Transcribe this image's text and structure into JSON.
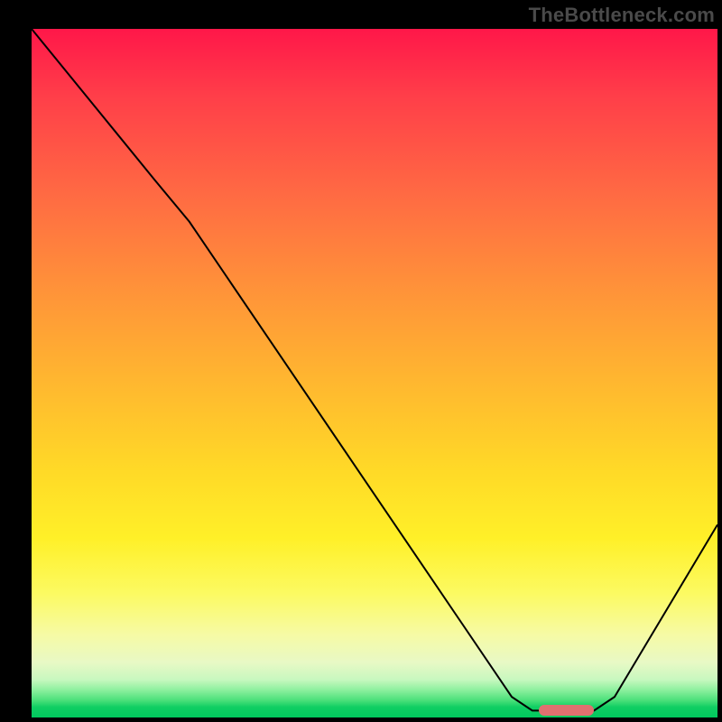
{
  "watermark": "TheBottleneck.com",
  "chart_data": {
    "type": "line",
    "title": "",
    "xlabel": "",
    "ylabel": "",
    "xlim": [
      0,
      100
    ],
    "ylim": [
      0,
      100
    ],
    "grid": false,
    "legend": false,
    "background_gradient": {
      "top": "#ff1749",
      "middle": "#ffd927",
      "bottom": "#00c95e",
      "note": "vertical gradient from red (top) through orange/yellow to green (bottom)"
    },
    "series": [
      {
        "name": "bottleneck-curve",
        "color": "#000000",
        "points": [
          {
            "x": 0,
            "y": 100
          },
          {
            "x": 18,
            "y": 78
          },
          {
            "x": 23,
            "y": 72
          },
          {
            "x": 70,
            "y": 3
          },
          {
            "x": 73,
            "y": 1
          },
          {
            "x": 82,
            "y": 1
          },
          {
            "x": 85,
            "y": 3
          },
          {
            "x": 100,
            "y": 28
          }
        ]
      }
    ],
    "annotations": [
      {
        "name": "optimal-marker",
        "type": "bar-segment",
        "x_start": 74,
        "x_end": 82,
        "y": 1,
        "color": "#e07070"
      }
    ]
  }
}
